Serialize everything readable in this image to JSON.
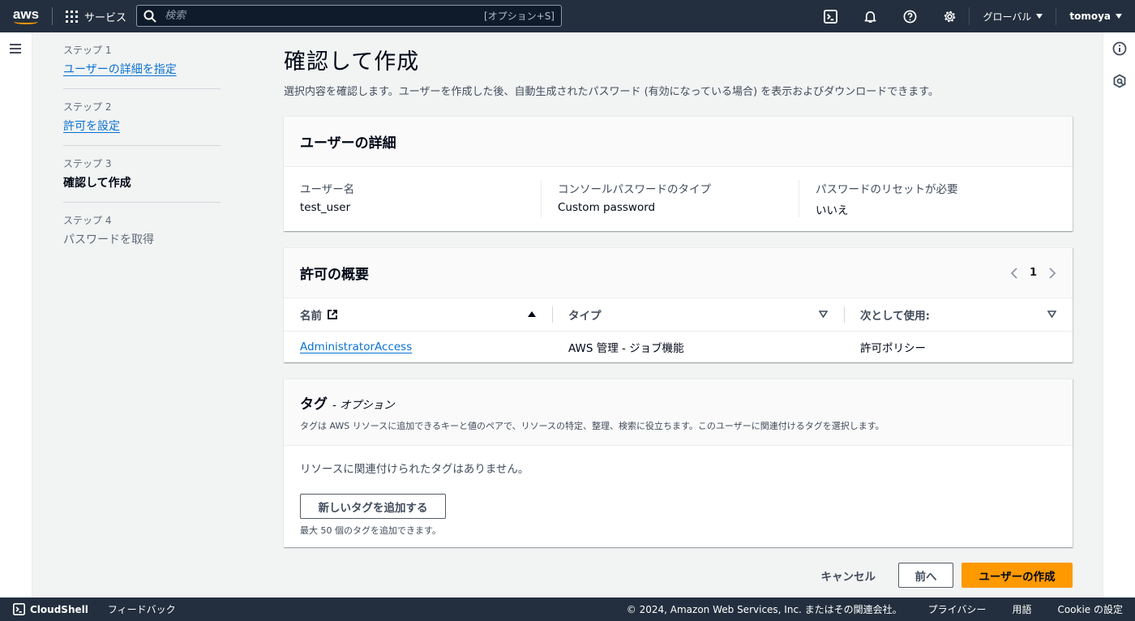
{
  "topbar": {
    "logo": "aws",
    "services_label": "サービス",
    "search_placeholder": "検索",
    "search_shortcut": "[オプション+S]",
    "region": "グローバル",
    "user": "tomoya",
    "icons": [
      "cloudshell-icon",
      "bell-icon",
      "help-icon",
      "gear-icon"
    ]
  },
  "steps": [
    {
      "num": "ステップ 1",
      "label": "ユーザーの詳細を指定",
      "state": "link"
    },
    {
      "num": "ステップ 2",
      "label": "許可を設定",
      "state": "link"
    },
    {
      "num": "ステップ 3",
      "label": "確認して作成",
      "state": "current"
    },
    {
      "num": "ステップ 4",
      "label": "パスワードを取得",
      "state": "disabled"
    }
  ],
  "page": {
    "title": "確認して作成",
    "description": "選択内容を確認します。ユーザーを作成した後、自動生成されたパスワード (有効になっている場合) を表示およびダウンロードできます。"
  },
  "user_details": {
    "title": "ユーザーの詳細",
    "fields": [
      {
        "key": "ユーザー名",
        "value": "test_user"
      },
      {
        "key": "コンソールパスワードのタイプ",
        "value": "Custom password"
      },
      {
        "key": "パスワードのリセットが必要",
        "value": "いいえ"
      }
    ]
  },
  "permissions": {
    "title": "許可の概要",
    "page_number": "1",
    "columns": [
      "名前",
      "タイプ",
      "次として使用:"
    ],
    "rows": [
      {
        "name": "AdministratorAccess",
        "type": "AWS 管理 - ジョブ機能",
        "used_as": "許可ポリシー"
      }
    ]
  },
  "tags": {
    "title": "タグ",
    "subtitle": "- オプション",
    "description": "タグは AWS リソースに追加できるキーと値のペアで、リソースの特定、整理、検索に役立ちます。このユーザーに関連付けるタグを選択します。",
    "empty_text": "リソースに関連付けられたタグはありません。",
    "add_button": "新しいタグを追加する",
    "hint": "最大 50 個のタグを追加できます。"
  },
  "actions": {
    "cancel": "キャンセル",
    "previous": "前へ",
    "create": "ユーザーの作成"
  },
  "footer": {
    "cloudshell": "CloudShell",
    "feedback": "フィードバック",
    "copyright": "© 2024, Amazon Web Services, Inc. またはその関連会社。",
    "privacy": "プライバシー",
    "terms": "用語",
    "cookie": "Cookie の設定"
  },
  "colors": {
    "topbar": "#232f3e",
    "primary": "#ff9900",
    "link": "#0972d3"
  }
}
